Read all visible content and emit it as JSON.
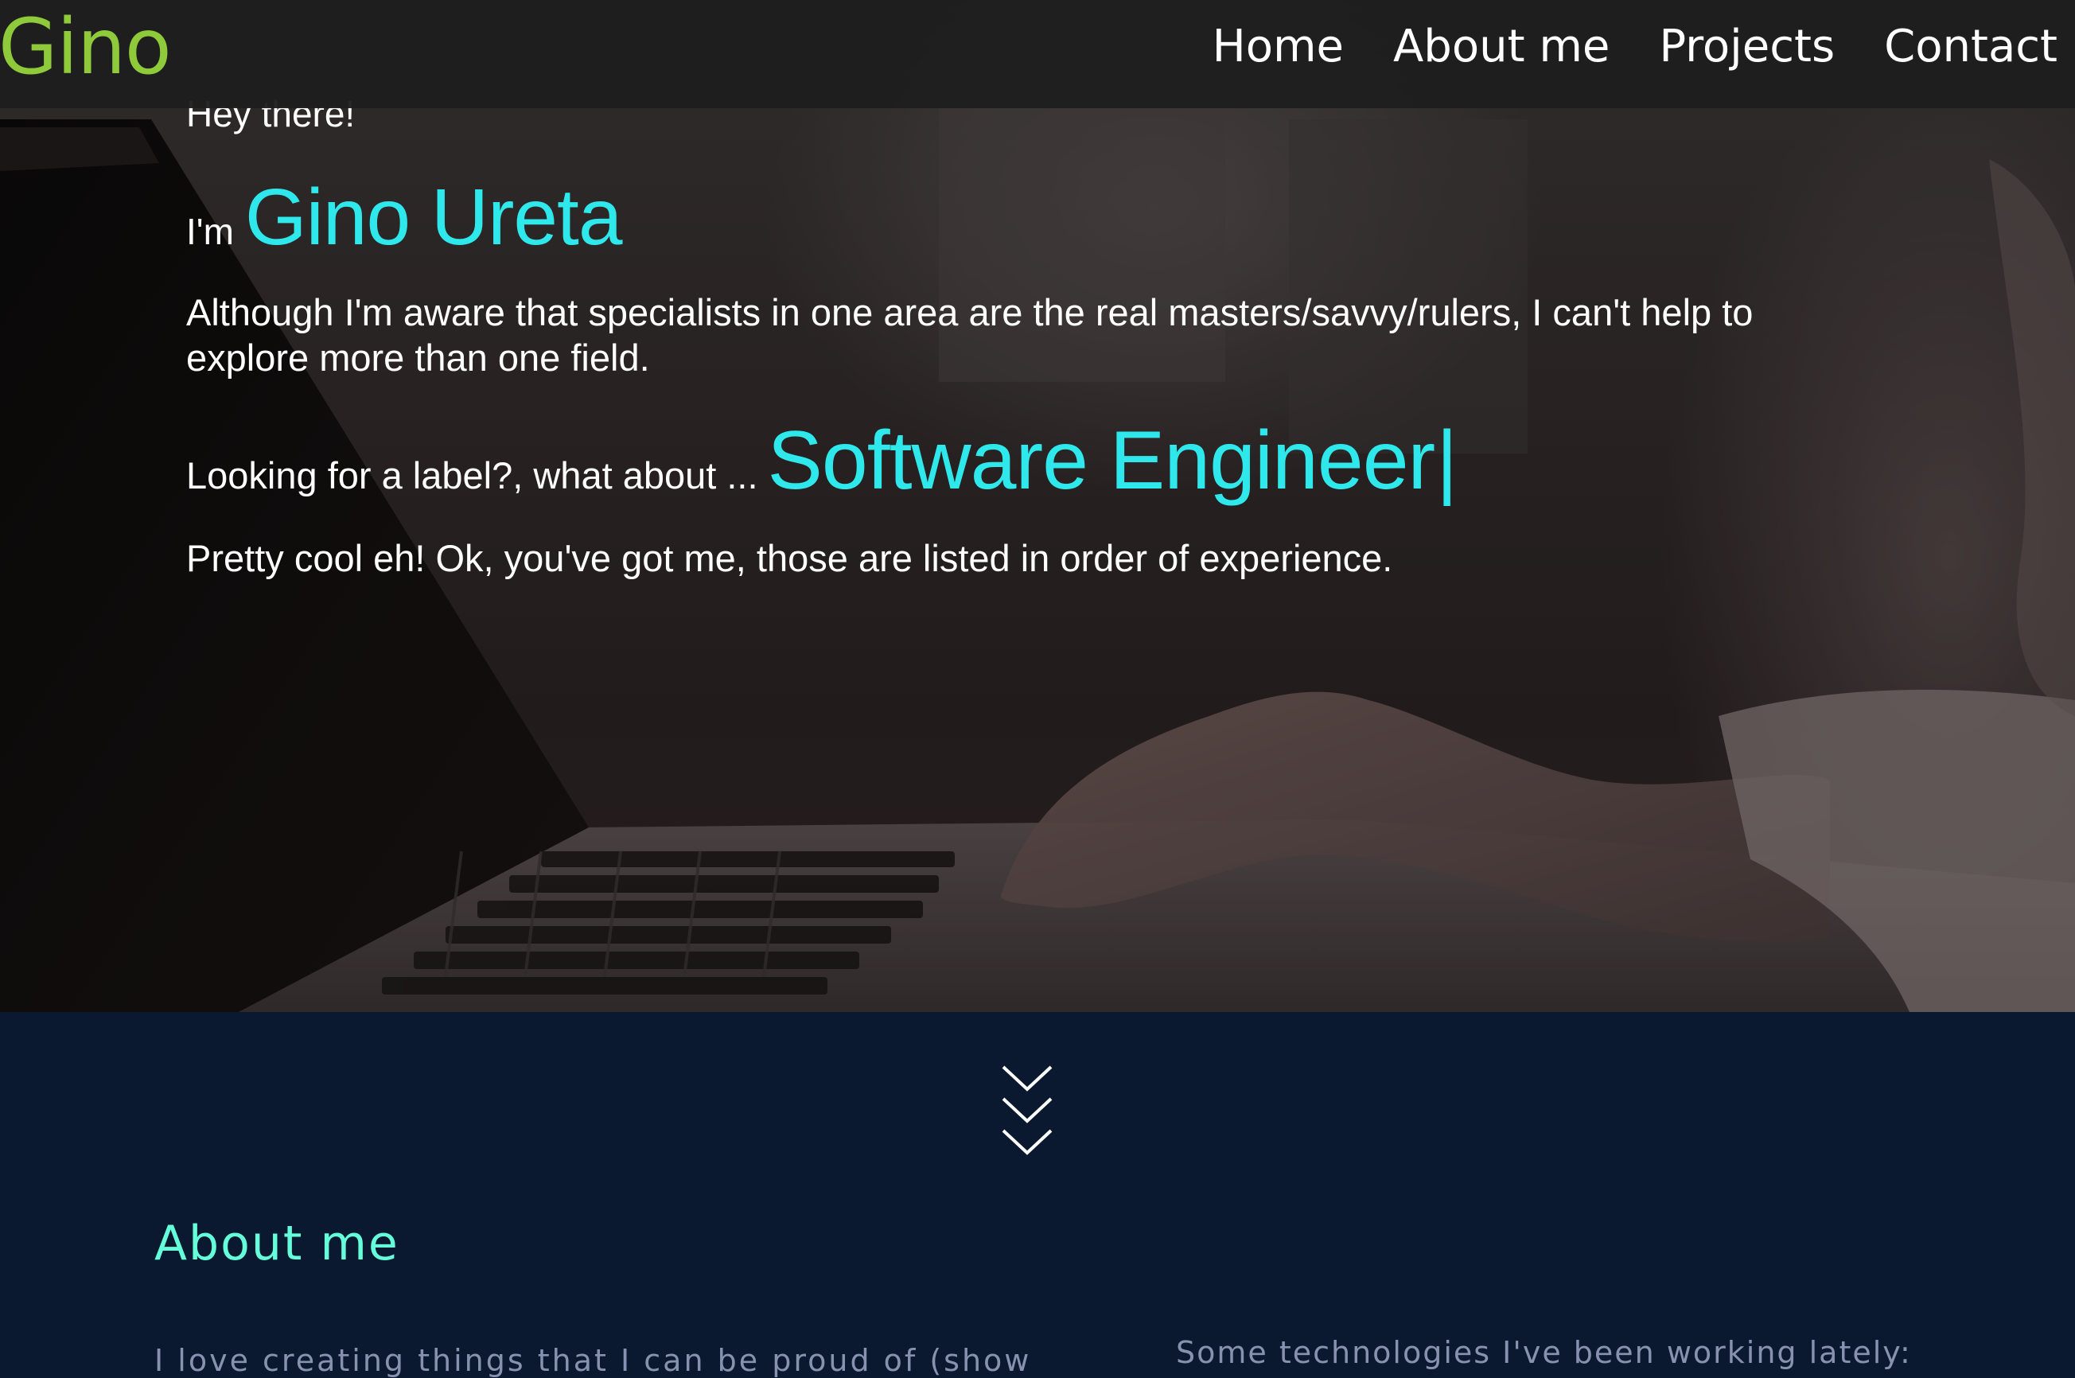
{
  "colors": {
    "brand": "#8fca3a",
    "accent_cyan": "#2ee8ec",
    "section_title": "#64ffda",
    "section_bg": "#0a1930",
    "muted_text": "#8892b0",
    "nav_bg": "#1e1e1e"
  },
  "nav": {
    "brand": "Gino",
    "links": [
      "Home",
      "About me",
      "Projects",
      "Contact"
    ]
  },
  "hero": {
    "greeting": "Hey there!",
    "intro_prefix": "I'm",
    "name": "Gino Ureta",
    "paragraph": "Although I'm aware that specialists in one area are the real masters/savvy/rulers, I can't help to explore more than one field.",
    "label_prefix": "Looking for a label?, what about ...",
    "typed_role": "Software Engineer",
    "typing_cursor": "|",
    "closing": "Pretty cool eh! Ok, you've got me, those are listed in order of experience.",
    "background_image": "person typing on a laptop"
  },
  "scroll_indicator": {
    "icon": "triple-chevron-down-icon"
  },
  "about": {
    "title": "About me",
    "intro_text": "I love creating things that I can be proud of (show",
    "tech_intro": "Some technologies I've been working lately:"
  }
}
